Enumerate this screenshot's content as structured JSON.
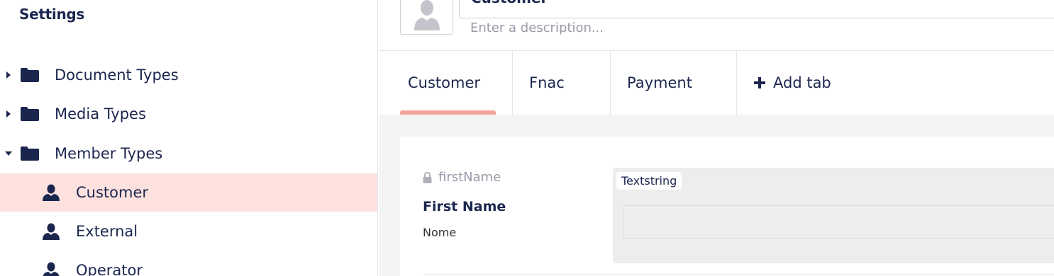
{
  "sidebar": {
    "title": "Settings",
    "items": [
      {
        "label": "Document Types",
        "icon": "folder-icon",
        "expander": "collapsed"
      },
      {
        "label": "Media Types",
        "icon": "folder-icon",
        "expander": "collapsed"
      },
      {
        "label": "Member Types",
        "icon": "folder-icon",
        "expander": "expanded"
      },
      {
        "label": "Customer",
        "icon": "member-icon",
        "selected": true
      },
      {
        "label": "External",
        "icon": "member-icon"
      },
      {
        "label": "Operator",
        "icon": "member-icon"
      }
    ]
  },
  "header": {
    "name": "Customer",
    "description_placeholder": "Enter a description..."
  },
  "tabs": [
    {
      "label": "Customer",
      "active": true
    },
    {
      "label": "Fnac"
    },
    {
      "label": "Payment"
    },
    {
      "label": "Add tab",
      "icon": "plus-icon"
    }
  ],
  "property": {
    "alias": "firstName",
    "label": "First Name",
    "description": "Nome",
    "editor": "Textstring"
  },
  "colors": {
    "primary_text": "#1b264f",
    "selected_bg": "#fde1de",
    "active_tab_indicator": "#f4a59b",
    "muted_text": "#9a9aa8",
    "content_bg": "#f5f4f4"
  }
}
